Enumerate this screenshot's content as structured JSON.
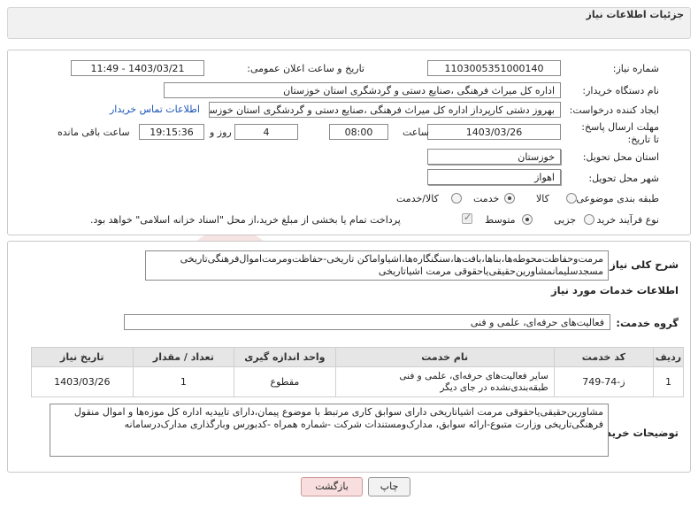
{
  "header": {
    "title": "جزئیات اطلاعات نیاز"
  },
  "form": {
    "need_number_label": "شماره نیاز:",
    "need_number": "1103005351000140",
    "announce_label": "تاریخ و ساعت اعلان عمومی:",
    "announce_value": "1403/03/21 - 11:49",
    "buyer_org_label": "نام دستگاه خریدار:",
    "buyer_org": "اداره کل میراث فرهنگی ،صنایع دستی و گردشگری استان خوزستان",
    "requester_label": "ایجاد کننده درخواست:",
    "requester": "بهروز دشتی کارپرداز اداره کل میراث فرهنگی ،صنایع دستی و گردشگری استان خوزستان",
    "contact_link": "اطلاعات تماس خریدار",
    "deadline_label": "مهلت ارسال پاسخ: تا تاریخ:",
    "deadline_date": "1403/03/26",
    "time_label": "ساعت",
    "deadline_time": "08:00",
    "days_value": "4",
    "days_label": "روز و",
    "remaining_time": "19:15:36",
    "remaining_label": "ساعت باقی مانده",
    "province_label": "استان محل تحویل:",
    "province": "خوزستان",
    "city_label": "شهر محل تحویل:",
    "city": "اهواز",
    "category_label": "طبقه بندی موضوعی:",
    "category_options": [
      "کالا",
      "خدمت",
      "کالا/خدمت"
    ],
    "category_selected": "خدمت",
    "process_label": "نوع فرآیند خرید :",
    "process_options": [
      "جزیی",
      "متوسط"
    ],
    "process_selected": "متوسط",
    "payment_note": "پرداخت تمام یا بخشی از مبلغ خرید،از محل \"اسناد خزانه اسلامی\" خواهد بود."
  },
  "summary": {
    "label": "شرح کلی نیاز:",
    "text": "مرمت‌وحفاظت‌محوطه‌ها،بناها،بافت‌ها،سنگنگاره‌ها،اشیاواماکن تاریخی-حفاظت‌ومرمت‌اموال‌فرهنگی‌تاریخی مسجدسلیمانمشاورین‌حقیقی‌یاحقوقی مرمت اشیاتاریخی"
  },
  "services": {
    "title": "اطلاعات خدمات مورد نیاز",
    "group_label": "گروه خدمت:",
    "group_value": "فعالیت‌های حرفه‌ای، علمی و فنی",
    "columns": [
      "ردیف",
      "کد خدمت",
      "نام خدمت",
      "واحد اندازه گیری",
      "تعداد / مقدار",
      "تاریخ نیاز"
    ],
    "rows": [
      {
        "index": "1",
        "code": "ز-74-749",
        "name": "سایر فعالیت‌های حرفه‌ای، علمی و فنی طبقه‌بندی‌نشده در جای دیگر",
        "unit": "مقطوع",
        "qty": "1",
        "date": "1403/03/26"
      }
    ]
  },
  "buyer_notes": {
    "label": "توضیحات خریدار:",
    "text": "مشاورین‌حقیقی‌یاحقوقی مرمت اشیاتاریخی دارای سوابق کاری مرتبط با موضوع پیمان،دارای تاییدیه اداره کل موزه‌ها و اموال منقول فرهنگی‌تاریخی وزارت متبوع-ارائه سوابق، مدارک‌ومستندات شرکت -شماره همراه -کدبورس وبارگذاری مدارک‌درسامانه"
  },
  "buttons": {
    "print": "چاپ",
    "back": "بازگشت"
  },
  "watermark": "AriaTender.net"
}
